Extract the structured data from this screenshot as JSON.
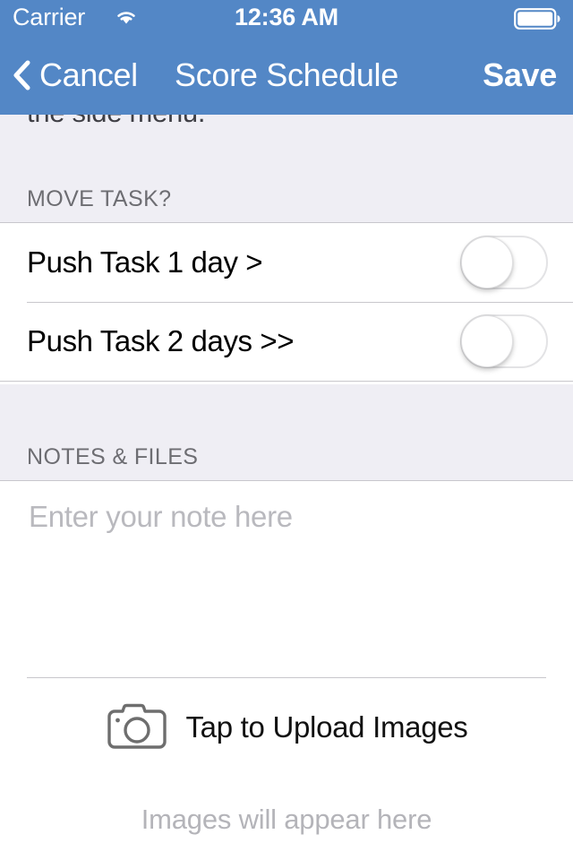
{
  "status_bar": {
    "carrier": "Carrier",
    "time": "12:36 AM",
    "wifi_icon": "wifi-icon",
    "battery_icon": "battery-full-icon"
  },
  "nav_bar": {
    "back_label": "Cancel",
    "back_icon": "chevron-left-icon",
    "title": "Score Schedule",
    "save_label": "Save",
    "background_color": "#5387C6",
    "text_color": "#FFFFFF"
  },
  "intro": {
    "clipped_text": "the side menu."
  },
  "sections": {
    "move_task": {
      "header": "MOVE TASK?",
      "rows": [
        {
          "label": "Push Task 1 day >",
          "toggle_state": "off"
        },
        {
          "label": "Push Task 2 days >>",
          "toggle_state": "off"
        }
      ]
    },
    "notes_files": {
      "header": "NOTES & FILES",
      "note_value": "",
      "note_placeholder": "Enter your note here",
      "upload_label": "Tap to Upload Images",
      "upload_icon": "camera-icon",
      "images_hint": "Images will appear here"
    }
  },
  "colors": {
    "group_background": "#EFEEF4",
    "separator": "#C8C7CC",
    "header_text": "#6D6D72",
    "placeholder_text": "#B9B9BE"
  }
}
